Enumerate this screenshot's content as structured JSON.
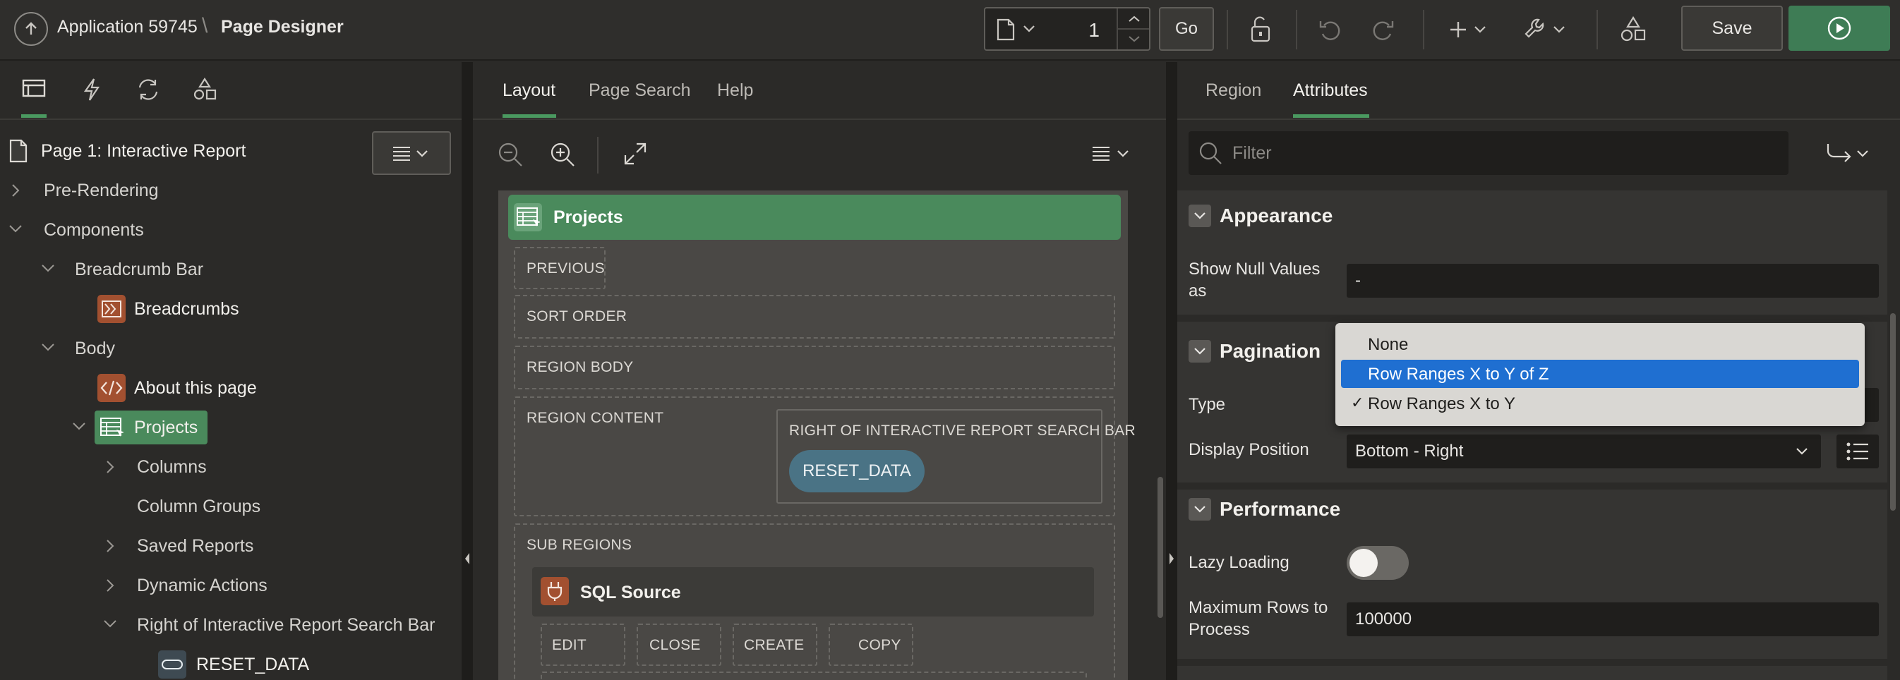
{
  "header": {
    "app_label": "Application 59745",
    "separator": "\\",
    "page_label": "Page Designer",
    "page_number": "1",
    "go_label": "Go",
    "save_label": "Save"
  },
  "left_panel": {
    "tree_root": "Page 1: Interactive Report",
    "nodes": {
      "pre_rendering": "Pre-Rendering",
      "components": "Components",
      "breadcrumb_bar": "Breadcrumb Bar",
      "breadcrumbs": "Breadcrumbs",
      "body": "Body",
      "about": "About this page",
      "projects": "Projects",
      "columns": "Columns",
      "column_groups": "Column Groups",
      "saved_reports": "Saved Reports",
      "dynamic_actions": "Dynamic Actions",
      "right_of_search": "Right of Interactive Report Search Bar",
      "reset_data": "RESET_DATA"
    }
  },
  "center_panel": {
    "tabs": [
      "Layout",
      "Page Search",
      "Help"
    ],
    "region_title": "Projects",
    "positions": {
      "previous": "PREVIOUS",
      "sort_order": "SORT ORDER",
      "region_body": "REGION BODY",
      "region_content": "REGION CONTENT",
      "right_of_search": "RIGHT OF INTERACTIVE REPORT SEARCH BAR",
      "sub_regions": "SUB REGIONS"
    },
    "reset_button": "RESET_DATA",
    "sub_region_title": "SQL Source",
    "sub_buttons": [
      "EDIT",
      "CLOSE",
      "CREATE",
      "COPY"
    ]
  },
  "right_panel": {
    "tabs": [
      "Region",
      "Attributes"
    ],
    "filter_placeholder": "Filter",
    "appearance": {
      "title": "Appearance",
      "null_label": "Show Null Values as",
      "null_value": "-"
    },
    "pagination": {
      "title": "Pagination",
      "type_label": "Type",
      "display_label": "Display Position",
      "display_value": "Bottom - Right"
    },
    "performance": {
      "title": "Performance",
      "lazy_label": "Lazy Loading",
      "lazy_on": false,
      "max_rows_label": "Maximum Rows to Process",
      "max_rows_value": "100000"
    }
  },
  "dropdown": {
    "options": [
      "None",
      "Row Ranges X to Y of Z",
      "Row Ranges X to Y"
    ],
    "highlighted": "Row Ranges X to Y of Z",
    "checked": "Row Ranges X to Y",
    "check_glyph": "✓"
  },
  "colors": {
    "accent_green": "#4a8a5c",
    "highlight_blue": "#1f6fd1",
    "pill_blue": "#4a7385",
    "icon_orange": "#a25030"
  }
}
